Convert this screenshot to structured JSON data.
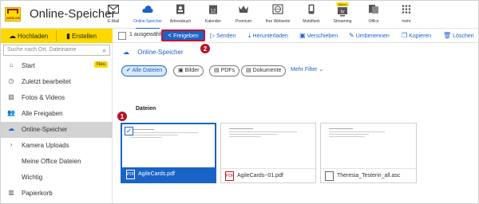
{
  "header": {
    "app_title": "Online-Speicher",
    "logo_text": "WEB.DE",
    "nav": [
      {
        "label": "E-Mail",
        "icon": "mail-icon"
      },
      {
        "label": "Online-Speicher",
        "icon": "cloud-icon",
        "active": true
      },
      {
        "label": "Adressbuch",
        "icon": "contacts-icon"
      },
      {
        "label": "Kalender",
        "icon": "calendar-icon"
      },
      {
        "label": "Premium",
        "icon": "crown-icon"
      },
      {
        "label": "Ihre Webseite",
        "icon": "globe-icon"
      },
      {
        "label": "Mobilfunk",
        "icon": "phone-icon"
      },
      {
        "label": "Streaming",
        "icon": "tv-icon",
        "badge": "Aktion"
      },
      {
        "label": "Office",
        "icon": "office-icon"
      },
      {
        "label": "mehr",
        "icon": "grid-icon"
      }
    ]
  },
  "left_toolbar": {
    "upload": "Hochladen",
    "create": "Erstellen"
  },
  "actionbar": {
    "selected_count": "1 ausgewählt",
    "share": "Freigeben",
    "send": "Senden",
    "download": "Herunterladen",
    "move": "Verschieben",
    "rename": "Umbenennen",
    "copy": "Kopieren",
    "delete": "Löschen"
  },
  "sidebar": {
    "search_placeholder": "Suche nach Ort, Dateiname",
    "items": [
      {
        "label": "Start",
        "icon": "home-icon",
        "badge": "Neu"
      },
      {
        "label": "Zuletzt bearbeitet",
        "icon": "clock-icon"
      },
      {
        "label": "Fotos & Videos",
        "icon": "image-icon"
      },
      {
        "label": "Alle Freigaben",
        "icon": "people-icon"
      },
      {
        "label": "Online-Speicher",
        "icon": "cloud-icon",
        "active": true
      },
      {
        "label": "Kamera Uploads",
        "icon": "chevron-right-icon"
      },
      {
        "label": "Meine Office Dateien",
        "icon": ""
      },
      {
        "label": "Wichtig",
        "icon": ""
      },
      {
        "label": "Papierkorb",
        "icon": "trash-icon"
      }
    ]
  },
  "main": {
    "breadcrumb": "Online-Speicher",
    "filters": [
      "Alle Dateien",
      "Bilder",
      "PDFs",
      "Dokumente"
    ],
    "more_filter": "Mehr Filter",
    "section_title": "Dateien",
    "files": [
      {
        "name": "AgileCards.pdf",
        "type": "PDF",
        "selected": true
      },
      {
        "name": "AgileCards~01.pdf",
        "type": "PDF",
        "selected": false
      },
      {
        "name": "Theresia_Testerin_all.asc",
        "type": "DOC",
        "selected": false
      }
    ]
  },
  "markers": [
    "1",
    "2"
  ],
  "colors": {
    "accent": "#1a63c7",
    "brand_yellow": "#ffd800",
    "marker_red": "#b3162b"
  }
}
